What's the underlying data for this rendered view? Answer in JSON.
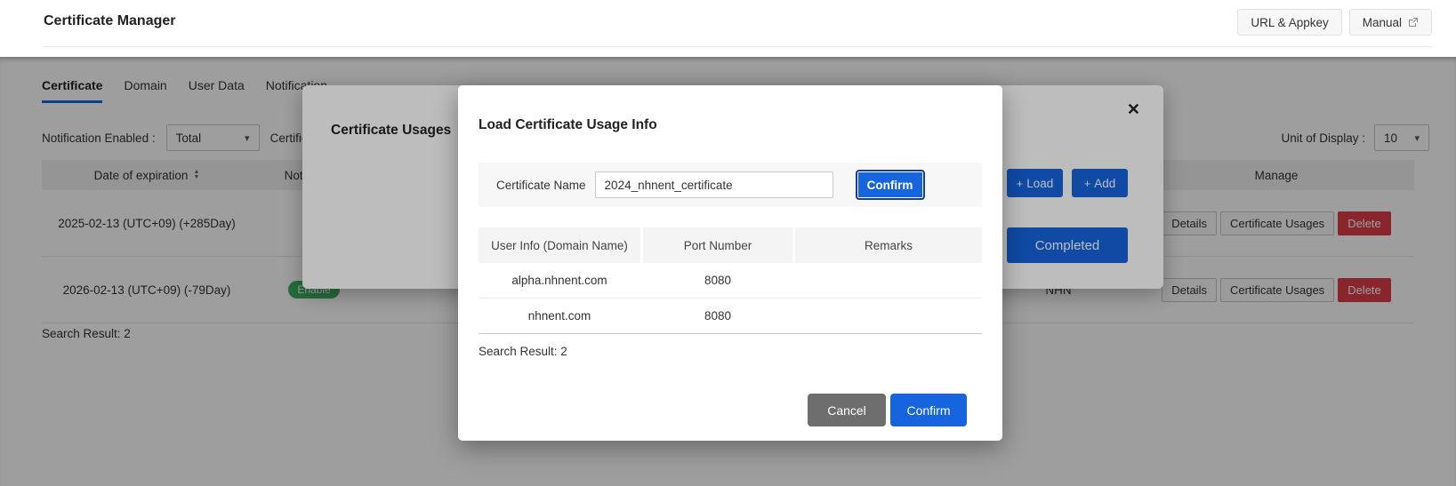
{
  "header": {
    "title": "Certificate Manager",
    "url_appkey_button": "URL & Appkey",
    "manual_button": "Manual"
  },
  "tabs": [
    {
      "label": "Certificate"
    },
    {
      "label": "Domain"
    },
    {
      "label": "User Data"
    },
    {
      "label": "Notification"
    }
  ],
  "filters": {
    "notification_enabled_label": "Notification Enabled :",
    "notification_enabled_value": "Total",
    "certificate_label": "Certificate",
    "unit_of_display_label": "Unit of Display :",
    "unit_of_display_value": "10"
  },
  "table": {
    "headers": {
      "date": "Date of expiration",
      "notification": "Notification",
      "manage": "Manage"
    },
    "rows": [
      {
        "date": "2025-02-13 (UTC+09) (+285Day)",
        "notification": "",
        "issuer": ""
      },
      {
        "date": "2026-02-13 (UTC+09) (-79Day)",
        "notification": "Enable",
        "issuer": "NHN"
      }
    ],
    "row_buttons": {
      "details": "Details",
      "usages": "Certificate Usages",
      "delete": "Delete"
    },
    "search_result": "Search Result: 2"
  },
  "back_modal": {
    "title": "Certificate Usages",
    "load_button": "Load",
    "add_button": "Add",
    "completed_button": "Completed"
  },
  "front_modal": {
    "title": "Load Certificate Usage Info",
    "certificate_name_label": "Certificate Name",
    "certificate_name_value": "2024_nhnent_certificate",
    "confirm_button": "Confirm",
    "table": {
      "headers": [
        "User Info (Domain Name)",
        "Port Number",
        "Remarks"
      ],
      "rows": [
        {
          "domain": "alpha.nhnent.com",
          "port": "8080",
          "remarks": ""
        },
        {
          "domain": "nhnent.com",
          "port": "8080",
          "remarks": ""
        }
      ]
    },
    "search_result": "Search Result: 2",
    "cancel_button": "Cancel",
    "confirm_footer_button": "Confirm"
  },
  "icons": {
    "plus": "+",
    "caret": "▾",
    "close": "✕",
    "sort_asc": "▲",
    "sort_desc": "▼"
  },
  "colors": {
    "accent_blue": "#1665de",
    "danger_red": "#dd3d49",
    "success_green": "#3fae63",
    "expired_red": "#e5484d"
  }
}
